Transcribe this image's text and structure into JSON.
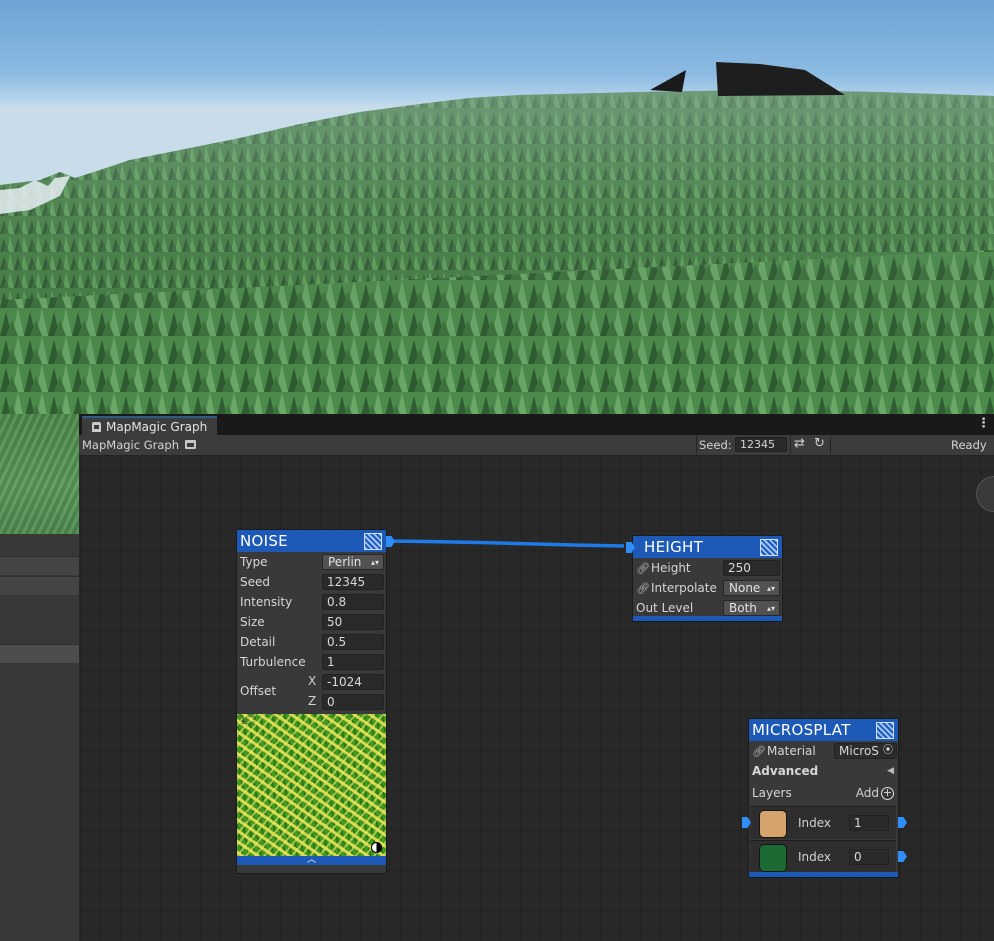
{
  "colors": {
    "accent": "#1d5ab7",
    "port": "#2f8ef7",
    "wire": "#1e7ae6",
    "layer1": "#d5a46c",
    "layer2": "#1d6b34"
  },
  "window": {
    "tab_title": "MapMagic Graph",
    "tab_icon": "mapmagic-icon",
    "toolbar": {
      "graph_name": "MapMagic Graph",
      "seed_label": "Seed:",
      "seed_value": "12345",
      "status": "Ready"
    }
  },
  "nodes": {
    "noise": {
      "title": "NOISE",
      "type_label": "Type",
      "type_value": "Perlin",
      "seed_label": "Seed",
      "seed_value": "12345",
      "intensity_label": "Intensity",
      "intensity_value": "0.8",
      "size_label": "Size",
      "size_value": "50",
      "detail_label": "Detail",
      "detail_value": "0.5",
      "turbulence_label": "Turbulence",
      "turbulence_value": "1",
      "offset_label": "Offset",
      "offset_x_label": "X",
      "offset_x_value": "-1024",
      "offset_z_label": "Z",
      "offset_z_value": "0"
    },
    "height": {
      "title": "HEIGHT",
      "height_label": "Height",
      "height_value": "250",
      "interpolate_label": "Interpolate",
      "interpolate_value": "None",
      "outlevel_label": "Out Level",
      "outlevel_value": "Both"
    },
    "microsplat": {
      "title": "MICROSPLAT",
      "material_label": "Material",
      "material_value": "MicroS",
      "advanced_label": "Advanced",
      "layers_label": "Layers",
      "add_label": "Add",
      "layers": [
        {
          "label": "Index",
          "value": "1"
        },
        {
          "label": "Index",
          "value": "0"
        }
      ]
    }
  }
}
